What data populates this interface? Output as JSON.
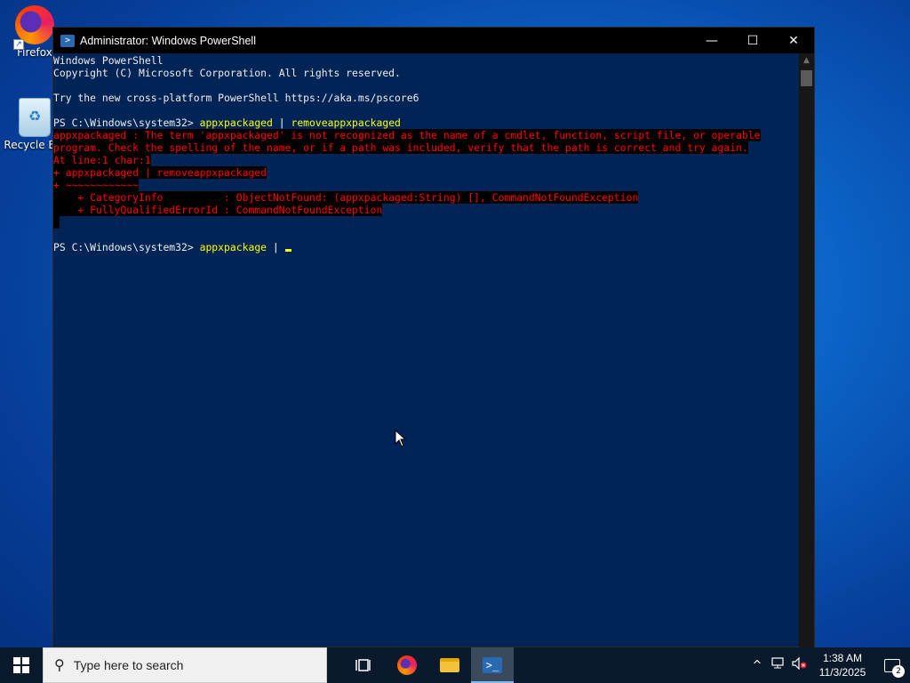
{
  "desktop": {
    "icons": [
      {
        "label": "Firefox"
      },
      {
        "label": "Recycle Bin"
      }
    ]
  },
  "window": {
    "title": "Administrator: Windows PowerShell",
    "controls": {
      "minimize": "—",
      "maximize": "☐",
      "close": "✕"
    }
  },
  "console": {
    "lines": {
      "l1": "Windows PowerShell",
      "l2": "Copyright (C) Microsoft Corporation. All rights reserved.",
      "l3": "",
      "l4": "Try the new cross-platform PowerShell https://aka.ms/pscore6",
      "l5": "",
      "prompt1": "PS C:\\Windows\\system32> ",
      "cmd1a": "appxpackaged",
      "cmd1op": " | ",
      "cmd1b": "removeappxpackaged",
      "e1": "appxpackaged : The term 'appxpackaged' is not recognized as the name of a cmdlet, function, script file, or operable",
      "e2": "program. Check the spelling of the name, or if a path was included, verify that the path is correct and try again.",
      "e3": "At line:1 char:1",
      "e4": "+ appxpackaged | removeappxpackaged",
      "e5": "+ ~~~~~~~~~~~~",
      "e6": "    + CategoryInfo          : ObjectNotFound: (appxpackaged:String) [], CommandNotFoundException",
      "e7": "    + FullyQualifiedErrorId : CommandNotFoundException",
      "e8": " ",
      "prompt2": "PS C:\\Windows\\system32> ",
      "cmd2a": "appxpackage",
      "cmd2op": " | "
    }
  },
  "taskbar": {
    "search_placeholder": "Type here to search",
    "apps": [
      "task-view",
      "firefox",
      "file-explorer",
      "powershell"
    ],
    "active_app": "powershell",
    "clock_time": "1:38 AM",
    "clock_date": "11/3/2025",
    "notification_count": "2"
  }
}
